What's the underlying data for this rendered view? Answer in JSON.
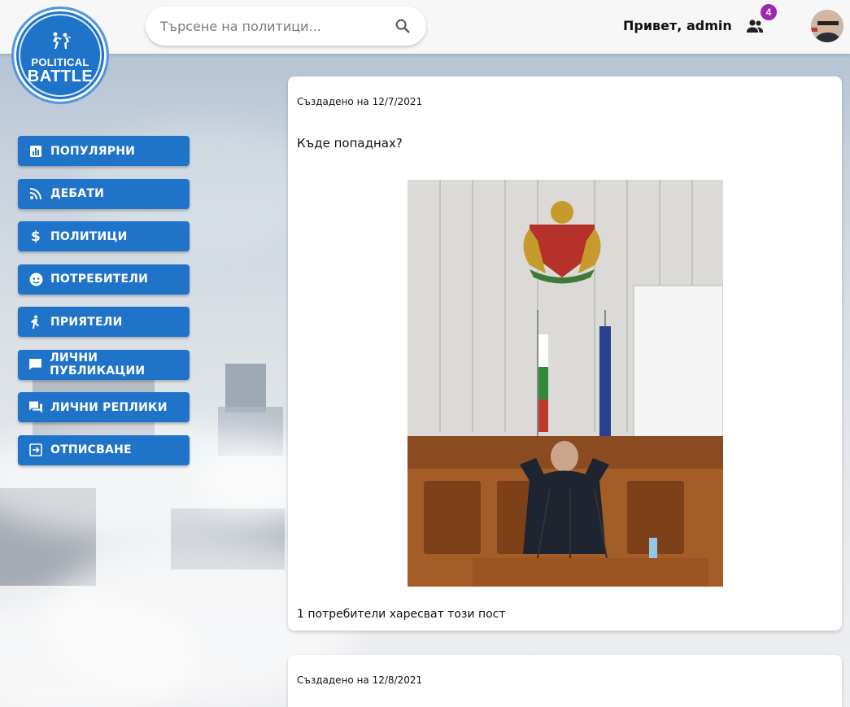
{
  "app": {
    "logo_line1": "POLITICAL",
    "logo_line2": "BATTLE"
  },
  "header": {
    "search_placeholder": "Търсене на политици...",
    "greeting": "Привет, admin",
    "friend_requests_count": "4",
    "icons": {
      "search": "search-icon",
      "friends": "people-icon",
      "avatar": "user-avatar"
    }
  },
  "sidebar": {
    "items": [
      {
        "label": "ПОПУЛЯРНИ",
        "icon": "bar-chart-icon"
      },
      {
        "label": "ДЕБАТИ",
        "icon": "rss-feed-icon"
      },
      {
        "label": "ПОЛИТИЦИ",
        "icon": "dollar-icon"
      },
      {
        "label": "ПОТРЕБИТЕЛИ",
        "icon": "face-icon"
      },
      {
        "label": "ПРИЯТЕЛИ",
        "icon": "person-running-icon"
      },
      {
        "label": "ЛИЧНИ ПУБЛИКАЦИИ",
        "icon": "chat-bubble-icon"
      },
      {
        "label": "ЛИЧНИ РЕПЛИКИ",
        "icon": "forum-icon"
      },
      {
        "label": "ОТПИСВАНЕ",
        "icon": "logout-icon"
      }
    ]
  },
  "posts": [
    {
      "created": "Създадено на 12/7/2021",
      "text": "Къде попаднах?",
      "likes": "1 потребители харесват този пост"
    },
    {
      "created": "Създадено на 12/8/2021"
    }
  ],
  "colors": {
    "primary": "#1f74c9",
    "badge": "#9c27b0",
    "header_bg": "#f7f7f7"
  }
}
